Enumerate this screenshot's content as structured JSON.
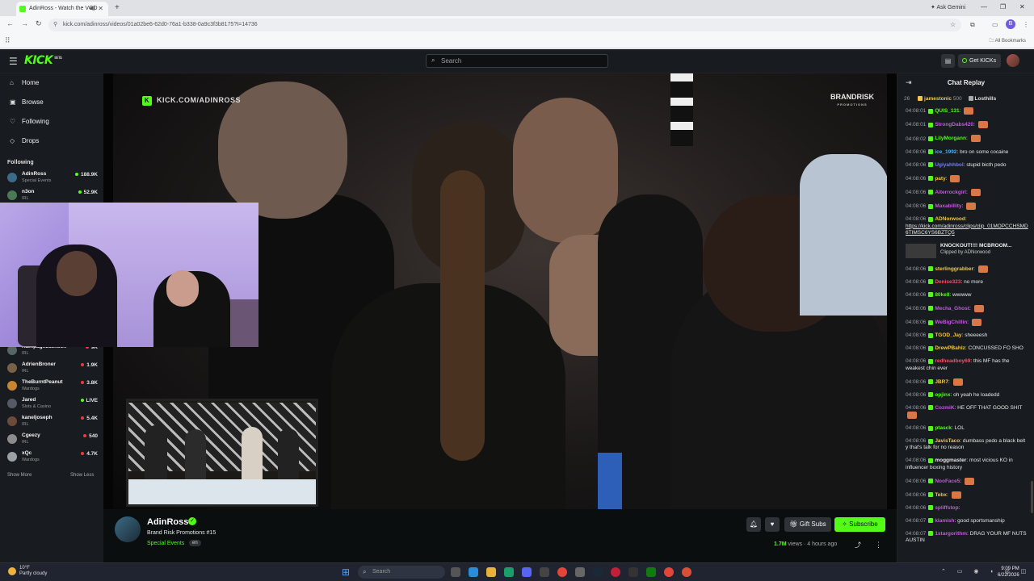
{
  "browser": {
    "tab_title": "AdinRoss - Watch the VOD",
    "new_tab": "+",
    "ask_gemini": "Ask Gemini",
    "url": "kick.com/adinross/videos/01a02be6-62d0-76a1-b338-0a9c3f3b8175?t=14736",
    "all_bookmarks": "All Bookmarks",
    "profile_initial": "B"
  },
  "header": {
    "logo": "KICK",
    "logo_tag": "BETA",
    "search_placeholder": "Search",
    "get_kicks": "Get KICKs"
  },
  "sidebar": {
    "nav": [
      {
        "label": "Home",
        "icon": "home-icon"
      },
      {
        "label": "Browse",
        "icon": "browse-icon"
      },
      {
        "label": "Following",
        "icon": "heart-icon"
      },
      {
        "label": "Drops",
        "icon": "drops-icon"
      }
    ],
    "following_heading": "Following",
    "channels": [
      {
        "name": "AdinRoss",
        "category": "Special Events",
        "viewers": "188.9K",
        "live": false
      },
      {
        "name": "n3on",
        "category": "IRL",
        "viewers": "52.9K",
        "live": false
      },
      {
        "name": "RampageJackson",
        "category": "IRL",
        "viewers": "9K",
        "live": false
      },
      {
        "name": "AdrienBroner",
        "category": "IRL",
        "viewers": "1.9K",
        "live": false
      },
      {
        "name": "TheBurntPeanut",
        "category": "Wardogs",
        "viewers": "3.8K",
        "live": false
      },
      {
        "name": "Jared",
        "category": "Slots & Casino",
        "viewers": "LIVE",
        "live": true
      },
      {
        "name": "kaneljoseph",
        "category": "IRL",
        "viewers": "5.4K",
        "live": false
      },
      {
        "name": "Cgeezy",
        "category": "IRL",
        "viewers": "540",
        "live": false
      },
      {
        "name": "xQc",
        "category": "Wardogs",
        "viewers": "4.7K",
        "live": false
      }
    ],
    "show_more": "Show More",
    "show_less": "Show Less"
  },
  "video": {
    "watermark": "KICK.COM/ADINROSS",
    "brand": "BRANDRISK",
    "brand_sub": "PROMOTIONS"
  },
  "stream_info": {
    "channel": "AdinRoss",
    "title": "Brand Risk Promotions #15",
    "category": "Special Events",
    "language": "en",
    "gift_subs": "Gift Subs",
    "subscribe": "Subscribe",
    "views": "1.7M",
    "views_label": "views",
    "age": "4 hours ago"
  },
  "chat": {
    "title": "Chat Replay",
    "pinned": [
      {
        "count": "26",
        "user": "jamestonic",
        "amount": "500",
        "user2": "Losthills"
      }
    ],
    "messages": [
      {
        "ts": "04:08:01",
        "user": "QUIS_131",
        "color": "#53fc18",
        "text": "",
        "emote": true
      },
      {
        "ts": "04:08:01",
        "user": "StrongDabs420",
        "color": "#c05bd9",
        "text": "",
        "emote": true
      },
      {
        "ts": "04:08:02",
        "user": "LilyMorgann",
        "color": "#53fc18",
        "text": "",
        "emote": true
      },
      {
        "ts": "04:08:06",
        "user": "ice_1992",
        "color": "#4ab0ff",
        "text": "bro on some cocaine",
        "emote": false
      },
      {
        "ts": "04:08:06",
        "user": "Ugiyahhbol",
        "color": "#6e7bff",
        "text": "stupid bicth pedo",
        "emote": false
      },
      {
        "ts": "04:08:06",
        "user": "paty",
        "color": "#f2c744",
        "text": "",
        "emote": true
      },
      {
        "ts": "04:08:06",
        "user": "Aiterrockgirl",
        "color": "#c05bd9",
        "text": "",
        "emote": true
      },
      {
        "ts": "04:08:06",
        "user": "Maxabillity",
        "color": "#c05bd9",
        "text": "",
        "emote": true
      },
      {
        "ts": "04:08:06",
        "user": "ADNorwood",
        "color": "#f2c744",
        "text": "https://kick.com/adinross/clips/clip_01MOPCCHSMD6TIMSC6YS6BZTQ5",
        "emote": false
      }
    ],
    "clip": {
      "title": "KNOCKOUT!!!! MCBROOM...",
      "by": "Clipped by ADNorwood"
    },
    "messages2": [
      {
        "ts": "04:08:06",
        "user": "sterlinggrabber",
        "color": "#f2c744",
        "text": "",
        "emote": true
      },
      {
        "ts": "04:08:06",
        "user": "Denise323",
        "color": "#e9566a",
        "text": "no more",
        "emote": false
      },
      {
        "ts": "04:08:06",
        "user": "80kell",
        "color": "#53fc18",
        "text": "wwwww",
        "emote": false
      },
      {
        "ts": "04:08:06",
        "user": "Mecha_Ghost",
        "color": "#c05bd9",
        "text": "",
        "emote": true
      },
      {
        "ts": "04:08:06",
        "user": "WeBigChillin",
        "color": "#c05bd9",
        "text": "",
        "emote": true
      },
      {
        "ts": "04:08:06",
        "user": "TGOD_Jay",
        "color": "#f2c744",
        "text": "sheeeesh",
        "emote": false
      },
      {
        "ts": "04:08:06",
        "user": "DrewPBahlz",
        "color": "#f2c744",
        "text": "CONCUSSED FO SHO",
        "emote": false
      },
      {
        "ts": "04:08:06",
        "user": "redheadboy69",
        "color": "#e9566a",
        "text": "this MF has the weakest chin ever",
        "emote": false
      },
      {
        "ts": "04:08:06",
        "user": "JBR7",
        "color": "#f2c744",
        "text": "",
        "emote": true
      },
      {
        "ts": "04:08:06",
        "user": "opjinx",
        "color": "#53fc18",
        "text": "oh yeah he loadedd",
        "emote": false
      },
      {
        "ts": "04:08:06",
        "user": "CozmiK",
        "color": "#c05bd9",
        "text": "HE OFF THAT GOOD SHIT",
        "emote": true
      },
      {
        "ts": "04:08:06",
        "user": "ptasck",
        "color": "#53fc18",
        "text": "LOL",
        "emote": false
      },
      {
        "ts": "04:08:06",
        "user": "JavisTaco",
        "color": "#f2c744",
        "text": "dumbass pedo a black belt y that's talk for no reason",
        "emote": false
      },
      {
        "ts": "04:08:06",
        "user": "moggmaster",
        "color": "#e6e6e6",
        "text": "most vicious KO in influencer boxing history",
        "emote": false
      },
      {
        "ts": "04:08:06",
        "user": "NooFace5",
        "color": "#c05bd9",
        "text": "",
        "emote": true
      },
      {
        "ts": "04:08:06",
        "user": "Tebx",
        "color": "#f2c744",
        "text": "",
        "emote": true
      },
      {
        "ts": "04:08:06",
        "user": "spliffstop",
        "color": "#c05bd9",
        "text": "",
        "emote": false
      },
      {
        "ts": "04:08:07",
        "user": "klamish",
        "color": "#c05bd9",
        "text": "good sportsmanship",
        "emote": false
      },
      {
        "ts": "04:08:07",
        "user": "1stargorithm",
        "color": "#c05bd9",
        "text": "DRAG YOUR MF NUTS AUSTIN",
        "emote": false
      }
    ]
  },
  "taskbar": {
    "temp": "10°F",
    "weather": "Partly cloudy",
    "search_placeholder": "Search",
    "time": "9:09 PM",
    "date": "6/22/2026"
  },
  "colors": {
    "kick_green": "#53fc18",
    "bg": "#0b0e0f",
    "panel": "#181b1f"
  }
}
